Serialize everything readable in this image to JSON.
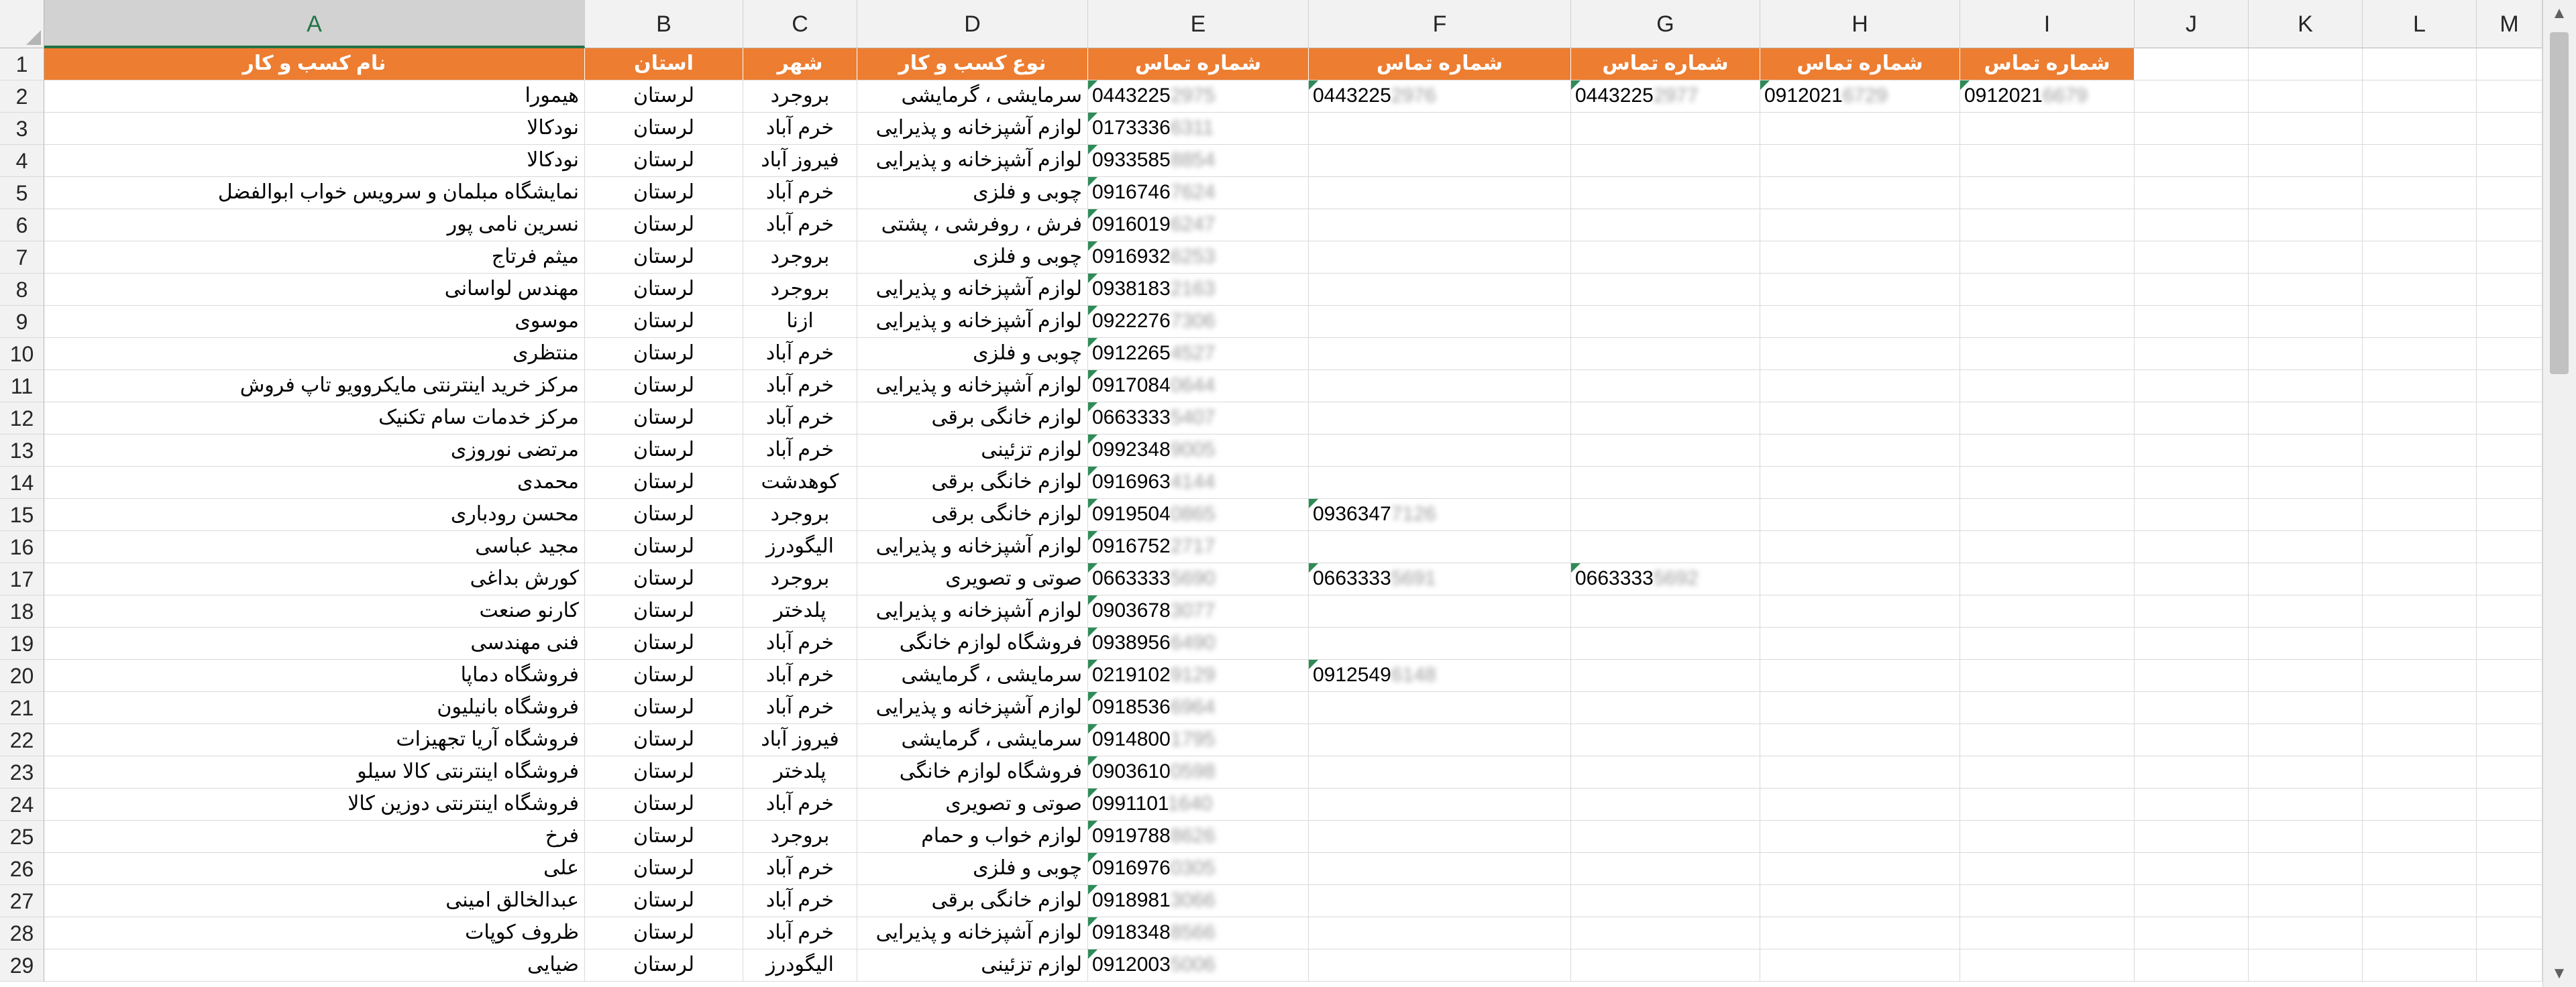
{
  "columns": [
    "A",
    "B",
    "C",
    "D",
    "E",
    "F",
    "G",
    "H",
    "I",
    "J",
    "K",
    "L",
    "M"
  ],
  "header_row": [
    "نام کسب و کار",
    "استان",
    "شهر",
    "نوع کسب و کار",
    "شماره تماس",
    "شماره تماس",
    "شماره تماس",
    "شماره تماس",
    "شماره تماس"
  ],
  "rows": [
    {
      "num": "2",
      "name": "هیمورا",
      "province": "لرستان",
      "city": "بروجرد",
      "type": "سرمایشی ، گرمایشی",
      "phones": [
        [
          "0443225",
          "2975"
        ],
        [
          "0443225",
          "2976"
        ],
        [
          "0443225",
          "2977"
        ],
        [
          "0912021",
          "6729"
        ],
        [
          "0912021",
          "6679"
        ]
      ]
    },
    {
      "num": "3",
      "name": "نودکالا",
      "province": "لرستان",
      "city": "خرم آباد",
      "type": "لوازم آشپزخانه و پذیرایی",
      "phones": [
        [
          "0173336",
          "6311"
        ]
      ]
    },
    {
      "num": "4",
      "name": "نودکالا",
      "province": "لرستان",
      "city": "فیروز آباد",
      "type": "لوازم آشپزخانه و پذیرایی",
      "phones": [
        [
          "0933585",
          "8854"
        ]
      ]
    },
    {
      "num": "5",
      "name": "نمایشگاه مبلمان و سرویس خواب ابوالفضل",
      "province": "لرستان",
      "city": "خرم آباد",
      "type": "چوبی و فلزی",
      "phones": [
        [
          "0916746",
          "7624"
        ]
      ]
    },
    {
      "num": "6",
      "name": "نسرین نامی پور",
      "province": "لرستان",
      "city": "خرم آباد",
      "type": "فرش ، روفرشی ، پشتی",
      "phones": [
        [
          "0916019",
          "6247"
        ]
      ]
    },
    {
      "num": "7",
      "name": "میثم فرتاج",
      "province": "لرستان",
      "city": "بروجرد",
      "type": "چوبی و فلزی",
      "phones": [
        [
          "0916932",
          "6253"
        ]
      ]
    },
    {
      "num": "8",
      "name": "مهندس لواسانی",
      "province": "لرستان",
      "city": "بروجرد",
      "type": "لوازم آشپزخانه و پذیرایی",
      "phones": [
        [
          "0938183",
          "2163"
        ]
      ]
    },
    {
      "num": "9",
      "name": "موسوی",
      "province": "لرستان",
      "city": "ازنا",
      "type": "لوازم آشپزخانه و پذیرایی",
      "phones": [
        [
          "0922276",
          "7306"
        ]
      ]
    },
    {
      "num": "10",
      "name": "منتظری",
      "province": "لرستان",
      "city": "خرم آباد",
      "type": "چوبی و فلزی",
      "phones": [
        [
          "0912265",
          "4527"
        ]
      ]
    },
    {
      "num": "11",
      "name": "مرکز خرید اینترنتی مایکروویو تاپ فروش",
      "province": "لرستان",
      "city": "خرم آباد",
      "type": "لوازم آشپزخانه و پذیرایی",
      "phones": [
        [
          "0917084",
          "0644"
        ]
      ]
    },
    {
      "num": "12",
      "name": "مرکز خدمات سام تکنیک",
      "province": "لرستان",
      "city": "خرم آباد",
      "type": "لوازم خانگی برقی",
      "phones": [
        [
          "0663333",
          "5407"
        ]
      ]
    },
    {
      "num": "13",
      "name": "مرتضی نوروزی",
      "province": "لرستان",
      "city": "خرم آباد",
      "type": "لوازم تزئینی",
      "phones": [
        [
          "0992348",
          "9005"
        ]
      ]
    },
    {
      "num": "14",
      "name": "محمدی",
      "province": "لرستان",
      "city": "کوهدشت",
      "type": "لوازم خانگی برقی",
      "phones": [
        [
          "0916963",
          "4144"
        ]
      ]
    },
    {
      "num": "15",
      "name": "محسن رودباری",
      "province": "لرستان",
      "city": "بروجرد",
      "type": "لوازم خانگی برقی",
      "phones": [
        [
          "0919504",
          "0865"
        ],
        [
          "0936347",
          "7126"
        ]
      ]
    },
    {
      "num": "16",
      "name": "مجید عباسی",
      "province": "لرستان",
      "city": "الیگودرز",
      "type": "لوازم آشپزخانه و پذیرایی",
      "phones": [
        [
          "0916752",
          "2717"
        ]
      ]
    },
    {
      "num": "17",
      "name": "کورش بداغی",
      "province": "لرستان",
      "city": "بروجرد",
      "type": "صوتی و تصویری",
      "phones": [
        [
          "0663333",
          "5690"
        ],
        [
          "0663333",
          "5691"
        ],
        [
          "0663333",
          "5692"
        ]
      ]
    },
    {
      "num": "18",
      "name": "کارنو صنعت",
      "province": "لرستان",
      "city": "پلدختر",
      "type": "لوازم آشپزخانه و پذیرایی",
      "phones": [
        [
          "0903678",
          "3077"
        ]
      ]
    },
    {
      "num": "19",
      "name": "فنی مهندسی",
      "province": "لرستان",
      "city": "خرم آباد",
      "type": "فروشگاه لوازم خانگی",
      "phones": [
        [
          "0938956",
          "6490"
        ]
      ]
    },
    {
      "num": "20",
      "name": "فروشگاه دماپا",
      "province": "لرستان",
      "city": "خرم آباد",
      "type": "سرمایشی ، گرمایشی",
      "phones": [
        [
          "0219102",
          "9129"
        ],
        [
          "0912549",
          "6148"
        ]
      ]
    },
    {
      "num": "21",
      "name": "فروشگاه بانیلیون",
      "province": "لرستان",
      "city": "خرم آباد",
      "type": "لوازم آشپزخانه و پذیرایی",
      "phones": [
        [
          "0918536",
          "6964"
        ]
      ]
    },
    {
      "num": "22",
      "name": "فروشگاه آریا تجهیزات",
      "province": "لرستان",
      "city": "فیروز آباد",
      "type": "سرمایشی ، گرمایشی",
      "phones": [
        [
          "0914800",
          "1795"
        ]
      ]
    },
    {
      "num": "23",
      "name": "فروشگاه اینترنتی کالا سیلو",
      "province": "لرستان",
      "city": "پلدختر",
      "type": "فروشگاه لوازم خانگی",
      "phones": [
        [
          "0903610",
          "0598"
        ]
      ]
    },
    {
      "num": "24",
      "name": "فروشگاه اینترنتی دوزین کالا",
      "province": "لرستان",
      "city": "خرم آباد",
      "type": "صوتی و تصویری",
      "phones": [
        [
          "0991101",
          "1640"
        ]
      ]
    },
    {
      "num": "25",
      "name": "فرخ",
      "province": "لرستان",
      "city": "بروجرد",
      "type": "لوازم خواب و حمام",
      "phones": [
        [
          "0919788",
          "8626"
        ]
      ]
    },
    {
      "num": "26",
      "name": "علی",
      "province": "لرستان",
      "city": "خرم آباد",
      "type": "چوبی و فلزی",
      "phones": [
        [
          "0916976",
          "0305"
        ]
      ]
    },
    {
      "num": "27",
      "name": "عبدالخالق امینی",
      "province": "لرستان",
      "city": "خرم آباد",
      "type": "لوازم خانگی برقی",
      "phones": [
        [
          "0918981",
          "3066"
        ]
      ]
    },
    {
      "num": "28",
      "name": "ظروف کوپات",
      "province": "لرستان",
      "city": "خرم آباد",
      "type": "لوازم آشپزخانه و پذیرایی",
      "phones": [
        [
          "0918348",
          "8566"
        ]
      ]
    },
    {
      "num": "29",
      "name": "ضیایی",
      "province": "لرستان",
      "city": "الیگودرز",
      "type": "لوازم تزئینی",
      "phones": [
        [
          "0912003",
          "5006"
        ]
      ]
    }
  ],
  "colors": {
    "header_fill": "#ed7d31",
    "header_text": "#ffffff",
    "selected_accent": "#217346",
    "gridline": "#d9d9d9",
    "error_indicator": "#2e8b57"
  }
}
